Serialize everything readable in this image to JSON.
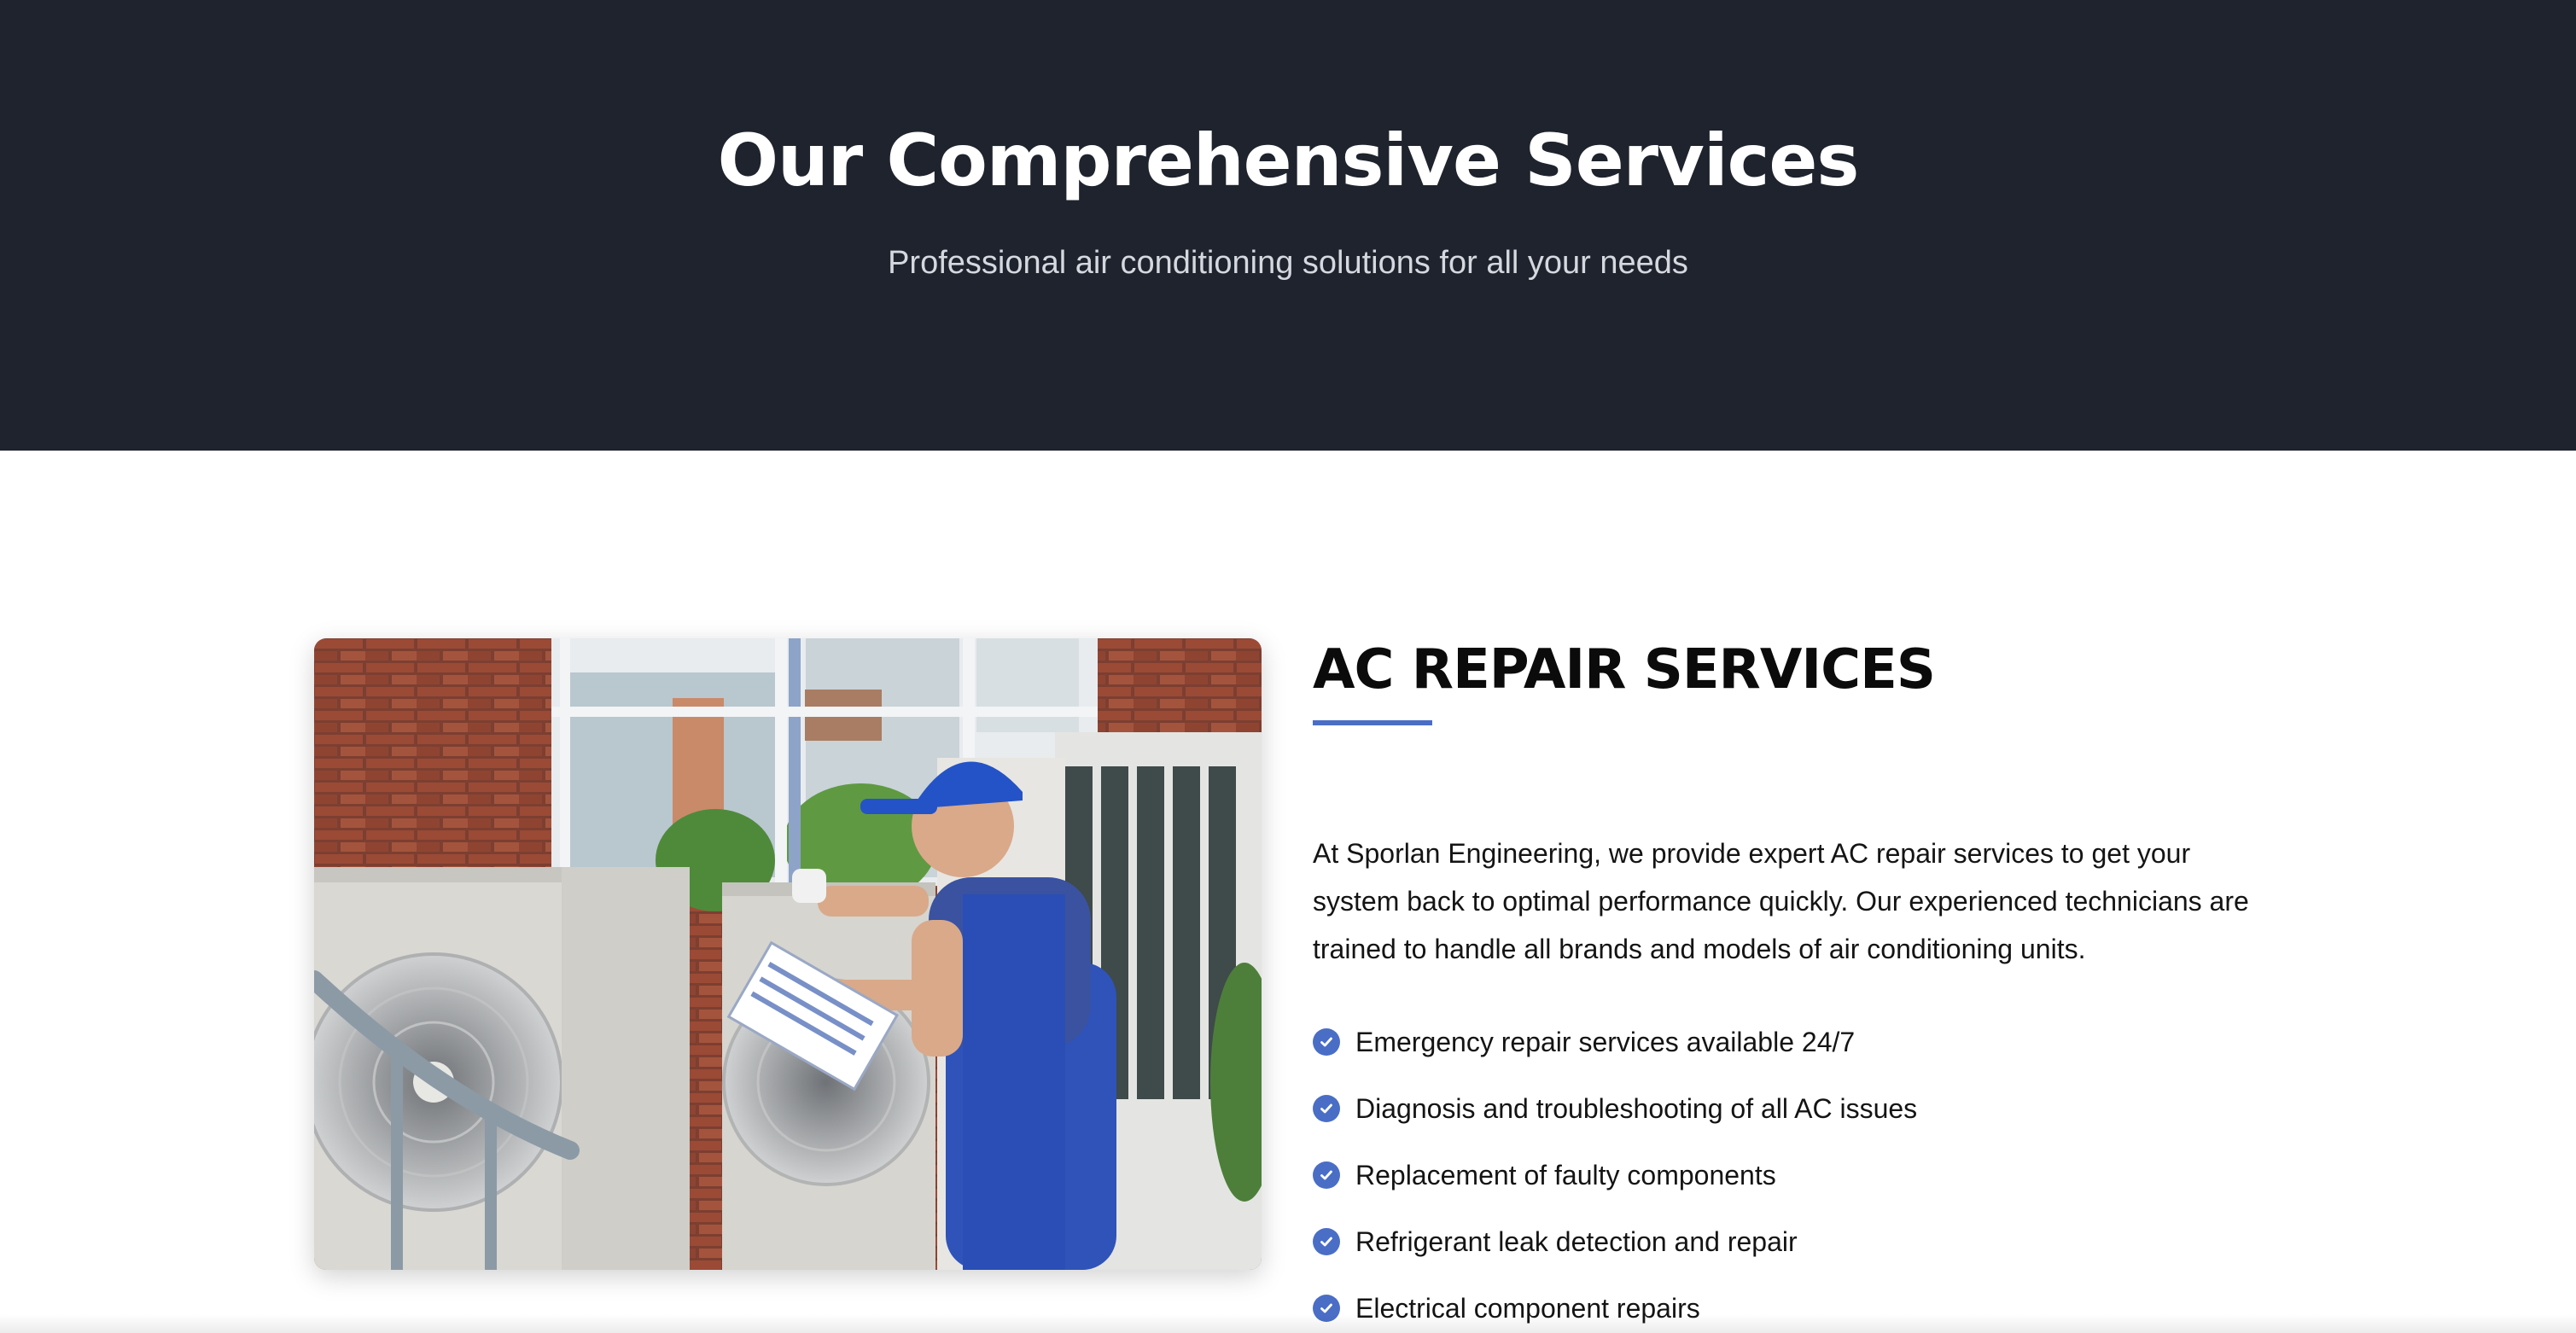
{
  "hero": {
    "title": "Our Comprehensive Services",
    "subtitle": "Professional air conditioning solutions for all your needs"
  },
  "service": {
    "title": "AC REPAIR SERVICES",
    "description": "At Sporlan Engineering, we provide expert AC repair services to get your system back to optimal performance quickly. Our experienced technicians are trained to handle all brands and models of air conditioning units.",
    "features": [
      {
        "label": "Emergency repair services available 24/7",
        "icon": "check-circle-icon"
      },
      {
        "label": "Diagnosis and troubleshooting of all AC issues",
        "icon": "check-circle-icon"
      },
      {
        "label": "Replacement of faulty components",
        "icon": "check-circle-icon"
      },
      {
        "label": "Refrigerant leak detection and repair",
        "icon": "check-circle-icon"
      },
      {
        "label": "Electrical component repairs",
        "icon": "check-circle-icon"
      }
    ]
  },
  "colors": {
    "hero_background": "#1e232d",
    "accent": "#4a6ec6",
    "text": "#141414"
  }
}
